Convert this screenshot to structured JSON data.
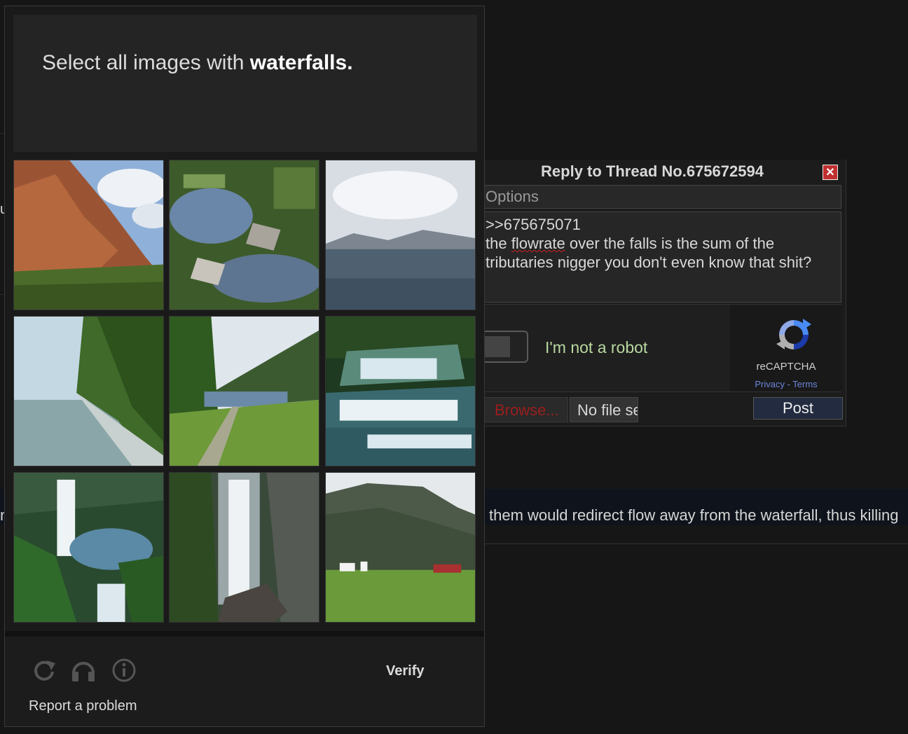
{
  "reply": {
    "title": "Reply to Thread No.675672594",
    "close_glyph": "✕",
    "options_placeholder": "Options",
    "comment_line1": ">>675675071",
    "comment_line2_pre": "the ",
    "comment_line2_misspelled": "flowrate",
    "comment_line2_post": " over the falls is the sum of the",
    "comment_line3": "tributaries nigger you don't even know that shit?",
    "browse_label": "Browse...",
    "file_status": "No file selected.",
    "post_label": "Post"
  },
  "recaptcha": {
    "checkbox_label": "I'm not a robot",
    "brand": "reCAPTCHA",
    "privacy": "Privacy",
    "separator": " - ",
    "terms": "Terms"
  },
  "challenge": {
    "prompt_pre": "Select all images with ",
    "prompt_target": "waterfalls.",
    "tiles": [
      {
        "label": "red cliff with sky"
      },
      {
        "label": "rocky stream"
      },
      {
        "label": "lake with mountains"
      },
      {
        "label": "river with trees"
      },
      {
        "label": "valley road by lake"
      },
      {
        "label": "cascading waterfall"
      },
      {
        "label": "waterfall in canyon"
      },
      {
        "label": "tall waterfall"
      },
      {
        "label": "mountain with houses"
      }
    ],
    "verify_label": "Verify",
    "report_label": "Report a problem",
    "icons": [
      "reload-icon",
      "headphones-icon",
      "info-icon"
    ]
  },
  "background": {
    "post_text": "them would redirect flow away from the waterfall, thus killing",
    "left_fragment": "n",
    "edge_fragment": "u"
  },
  "colors": {
    "background": "#161616",
    "accent_link": "#6a86d8",
    "recaptcha_label": "#b8d8a0",
    "browse_text": "#9b1d1d"
  }
}
